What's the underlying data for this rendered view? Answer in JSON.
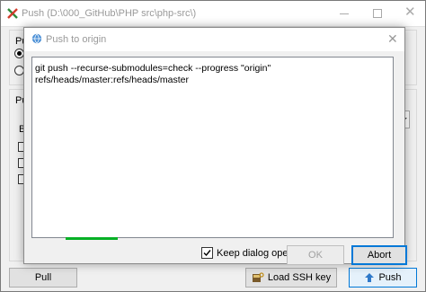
{
  "back_window": {
    "title": "Push (D:\\000_GitHub\\PHP src\\php-src\\)",
    "label_fragments": [
      "Pu",
      "Pu",
      "Br"
    ],
    "buttons": {
      "pull": "Pull",
      "load_ssh_key": "Load SSH key",
      "push": "Push"
    }
  },
  "dialog": {
    "title": "Push to origin",
    "log_lines": [
      "git push --recurse-submodules=check --progress \"origin\"",
      "refs/heads/master:refs/heads/master"
    ],
    "progress": 0.15,
    "keep_dialog_open": {
      "label": "Keep dialog open",
      "checked": true
    },
    "buttons": {
      "ok": "OK",
      "abort": "Abort"
    }
  },
  "colors": {
    "progress": "#06b025",
    "focus": "#0078d7",
    "titlebar": "#ffffff",
    "background": "#f0f0f0"
  }
}
